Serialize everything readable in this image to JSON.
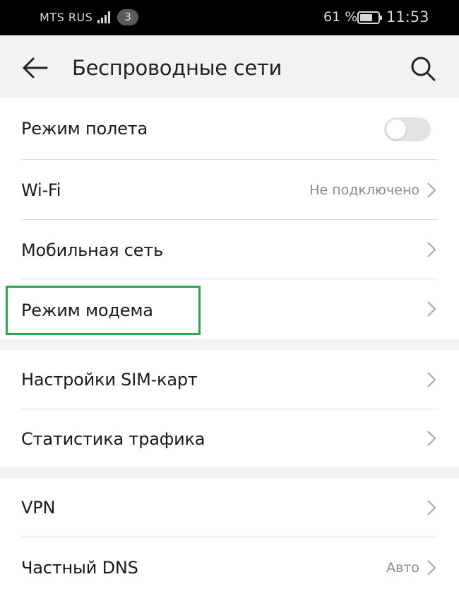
{
  "status_bar": {
    "carrier": "MTS RUS",
    "sim_badge": "3",
    "battery_percent": "61 %",
    "time": "11:53",
    "signal_icon": "signal-bars-icon",
    "battery_icon": "battery-icon"
  },
  "header": {
    "title": "Беспроводные сети",
    "back_icon": "arrow-left-icon",
    "search_icon": "search-icon"
  },
  "settings": {
    "airplane": {
      "label": "Режим полета",
      "toggle_on": false
    },
    "wifi": {
      "label": "Wi-Fi",
      "value": "Не подключено"
    },
    "mobile_network": {
      "label": "Мобильная сеть"
    },
    "tethering": {
      "label": "Режим модема",
      "highlighted": true
    },
    "sim_settings": {
      "label": "Настройки SIM-карт"
    },
    "traffic_stats": {
      "label": "Статистика трафика"
    },
    "vpn": {
      "label": "VPN"
    },
    "private_dns": {
      "label": "Частный DNS",
      "value": "Авто"
    }
  },
  "colors": {
    "highlight": "#2fa84f",
    "status_bar_bg": "#000000",
    "header_bg": "#f2f2f2"
  }
}
